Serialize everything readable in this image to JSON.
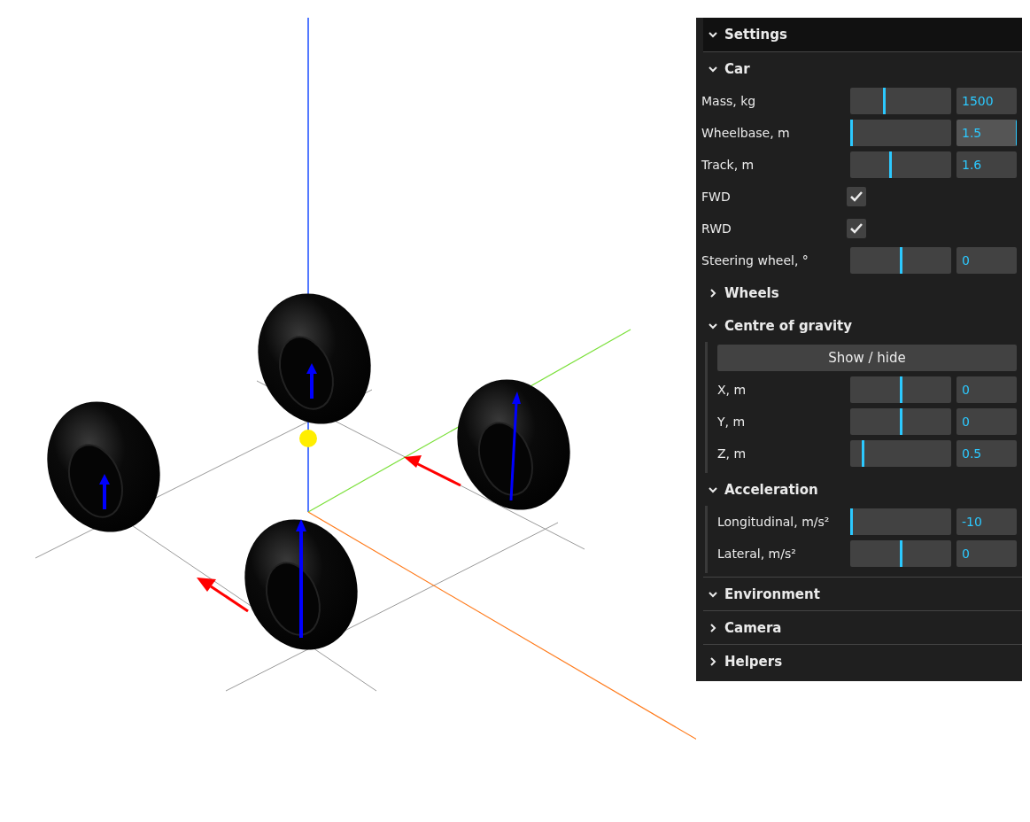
{
  "panel": {
    "title": "Settings",
    "expanded": true,
    "folders": [
      {
        "title": "Car",
        "expanded": true,
        "items": [
          {
            "kind": "slider",
            "label": "Mass, kg",
            "level": 0.33,
            "value": "1500",
            "focused": false
          },
          {
            "kind": "slider",
            "label": "Wheelbase, m",
            "level": 0,
            "value": "1.5",
            "focused": true
          },
          {
            "kind": "slider",
            "label": "Track, m",
            "level": 0.4,
            "value": "1.6",
            "focused": false
          },
          {
            "kind": "checkbox",
            "label": "FWD",
            "checked": true
          },
          {
            "kind": "checkbox",
            "label": "RWD",
            "checked": true
          },
          {
            "kind": "slider",
            "label": "Steering wheel, °",
            "level": 0.5,
            "value": "0",
            "focused": false
          },
          {
            "kind": "folder",
            "title": "Wheels",
            "expanded": false
          },
          {
            "kind": "folder",
            "title": "Centre of gravity",
            "expanded": true,
            "items": [
              {
                "kind": "button",
                "label": "Show / hide"
              },
              {
                "kind": "slider",
                "label": "X, m",
                "level": 0.5,
                "value": "0",
                "focused": false
              },
              {
                "kind": "slider",
                "label": "Y, m",
                "level": 0.5,
                "value": "0",
                "focused": false
              },
              {
                "kind": "slider",
                "label": "Z, m",
                "level": 0.12,
                "value": "0.5",
                "focused": false
              }
            ]
          },
          {
            "kind": "folder",
            "title": "Acceleration",
            "expanded": true,
            "items": [
              {
                "kind": "slider",
                "label": "Longitudinal, m/s²",
                "level": 0,
                "value": "-10",
                "focused": false
              },
              {
                "kind": "slider",
                "label": "Lateral, m/s²",
                "level": 0.5,
                "value": "0",
                "focused": false
              }
            ]
          }
        ]
      },
      {
        "title": "Environment",
        "expanded": true
      },
      {
        "title": "Camera",
        "expanded": false
      },
      {
        "title": "Helpers",
        "expanded": false
      }
    ]
  }
}
